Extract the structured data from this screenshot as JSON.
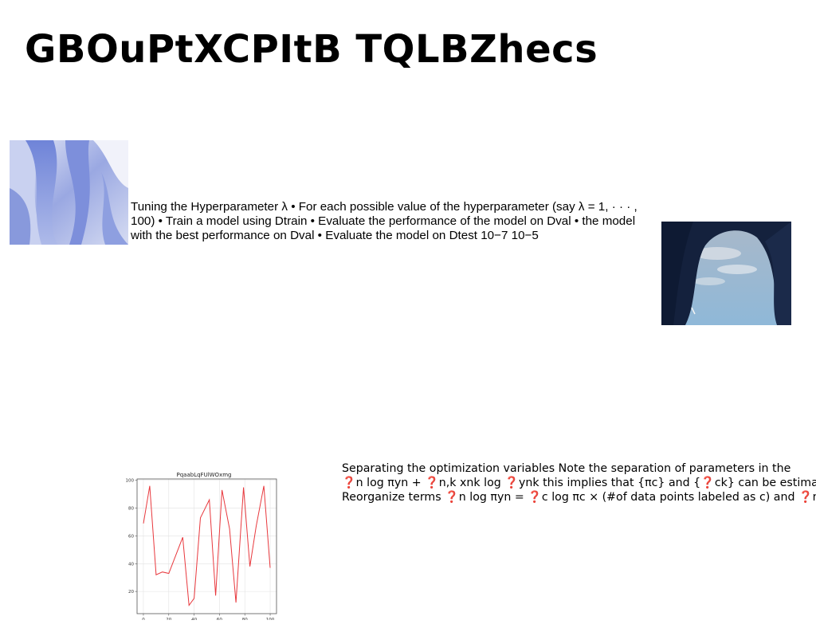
{
  "slide": {
    "title": "GBOuPtXCPItB TQLBZhecs",
    "paragraph1": "Tuning the Hyperparameter λ • For each possible value of the hyperparameter (say λ = 1, · · · , 100) • Train a model using Dtrain • Evaluate the performance of the model on Dval • the model with the best performance on Dval • Evaluate the model on Dtest 10−7 10−5",
    "paragraph2_lines": [
      "Separating the optimization variables Note the separation of parameters in the",
      "❓n log πyn + ❓n,k xnk log ❓ynk this implies that {πc} and {❓ck} can be estimated",
      "Reorganize terms ❓n log πyn = ❓c log πc × (#of data points labeled as c) and ❓n,k"
    ]
  },
  "chart_data": {
    "type": "line",
    "title": "PqaabLqFUlWOxmg",
    "xlabel": "",
    "ylabel": "",
    "xlim": [
      -5,
      105
    ],
    "ylim": [
      4,
      101
    ],
    "xticks": [
      0,
      20,
      40,
      60,
      80,
      100
    ],
    "yticks": [
      20,
      40,
      60,
      80,
      100
    ],
    "grid": true,
    "series": [
      {
        "color": "#e8383d",
        "x": [
          0,
          5,
          10,
          15,
          20,
          31,
          36,
          40,
          45,
          52,
          57,
          62,
          68,
          73,
          79,
          84,
          89,
          95,
          100
        ],
        "y": [
          69,
          96,
          32,
          34,
          33,
          59,
          10,
          15,
          73,
          86,
          17,
          93,
          65,
          12,
          95,
          38,
          67,
          96,
          37
        ]
      }
    ]
  }
}
